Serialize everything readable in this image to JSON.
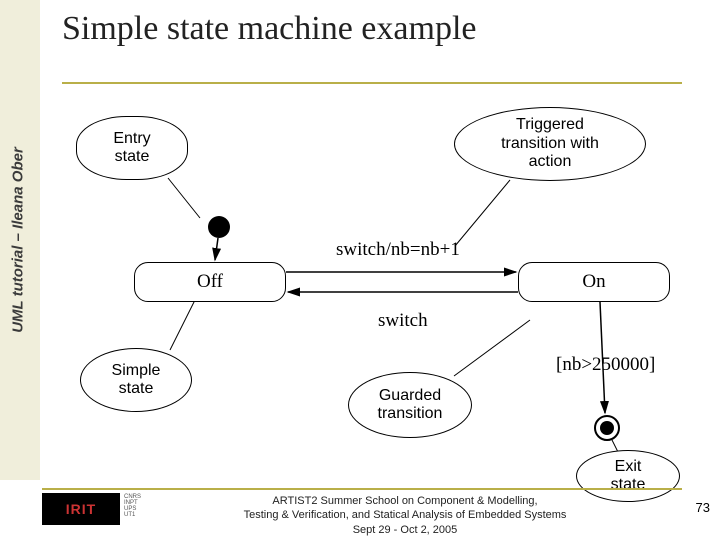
{
  "sidebar_label": "UML tutorial – Ileana Ober",
  "title": "Simple state machine example",
  "callouts": {
    "entry": "Entry\nstate",
    "triggered": "Triggered\ntransition with\naction",
    "simple": "Simple\nstate",
    "guarded": "Guarded\ntransition",
    "exit": "Exit\nstate"
  },
  "states": {
    "off": "Off",
    "on": "On"
  },
  "labels": {
    "trigger_action": "switch/nb=nb+1",
    "trigger_back": "switch",
    "guard": "[nb>250000]"
  },
  "logo": {
    "main": "IRIT",
    "sub": "CNRS\nINPT\nUPS\nUT1"
  },
  "footer": {
    "line1": "ARTIST2 Summer School on Component & Modelling,",
    "line2": "Testing & Verification, and Statical Analysis of Embedded Systems",
    "line3": "Sept 29 - Oct 2, 2005"
  },
  "page_number": "73"
}
